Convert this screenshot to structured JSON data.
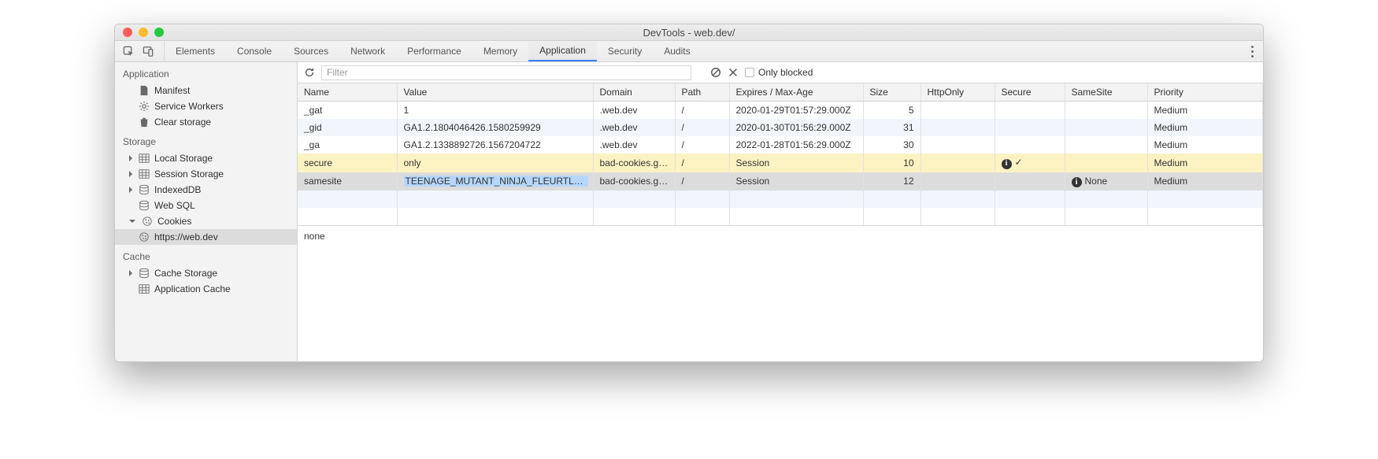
{
  "window_title": "DevTools - web.dev/",
  "tabs": {
    "items": [
      "Elements",
      "Console",
      "Sources",
      "Network",
      "Performance",
      "Memory",
      "Application",
      "Security",
      "Audits"
    ],
    "active": "Application"
  },
  "toolbar": {
    "filter_placeholder": "Filter",
    "only_blocked_label": "Only blocked"
  },
  "sidebar": {
    "application": {
      "header": "Application",
      "items": [
        "Manifest",
        "Service Workers",
        "Clear storage"
      ]
    },
    "storage": {
      "header": "Storage",
      "local_storage": "Local Storage",
      "session_storage": "Session Storage",
      "indexeddb": "IndexedDB",
      "websql": "Web SQL",
      "cookies": "Cookies",
      "cookies_origin": "https://web.dev"
    },
    "cache": {
      "header": "Cache",
      "cache_storage": "Cache Storage",
      "app_cache": "Application Cache"
    }
  },
  "table": {
    "headers": {
      "name": "Name",
      "value": "Value",
      "domain": "Domain",
      "path": "Path",
      "expires": "Expires / Max-Age",
      "size": "Size",
      "httponly": "HttpOnly",
      "secure": "Secure",
      "samesite": "SameSite",
      "priority": "Priority"
    },
    "rows": [
      {
        "name": "_gat",
        "value": "1",
        "domain": ".web.dev",
        "path": "/",
        "expires": "2020-01-29T01:57:29.000Z",
        "size": "5",
        "httponly": "",
        "secure": "",
        "samesite": "",
        "priority": "Medium",
        "state": ""
      },
      {
        "name": "_gid",
        "value": "GA1.2.1804046426.1580259929",
        "domain": ".web.dev",
        "path": "/",
        "expires": "2020-01-30T01:56:29.000Z",
        "size": "31",
        "httponly": "",
        "secure": "",
        "samesite": "",
        "priority": "Medium",
        "state": ""
      },
      {
        "name": "_ga",
        "value": "GA1.2.1338892726.1567204722",
        "domain": ".web.dev",
        "path": "/",
        "expires": "2022-01-28T01:56:29.000Z",
        "size": "30",
        "httponly": "",
        "secure": "",
        "samesite": "",
        "priority": "Medium",
        "state": ""
      },
      {
        "name": "secure",
        "value": "only",
        "domain": "bad-cookies.g…",
        "path": "/",
        "expires": "Session",
        "size": "10",
        "httponly": "",
        "secure": "warn-check",
        "samesite": "",
        "priority": "Medium",
        "state": "highlight"
      },
      {
        "name": "samesite",
        "value": "TEENAGE_MUTANT_NINJA_FLEURTLES",
        "domain": "bad-cookies.g…",
        "path": "/",
        "expires": "Session",
        "size": "12",
        "httponly": "",
        "secure": "",
        "samesite": "warn-none",
        "priority": "Medium",
        "state": "selected"
      }
    ],
    "samesite_none_text": "None",
    "secure_check": "✓"
  },
  "bottom_value": "none"
}
